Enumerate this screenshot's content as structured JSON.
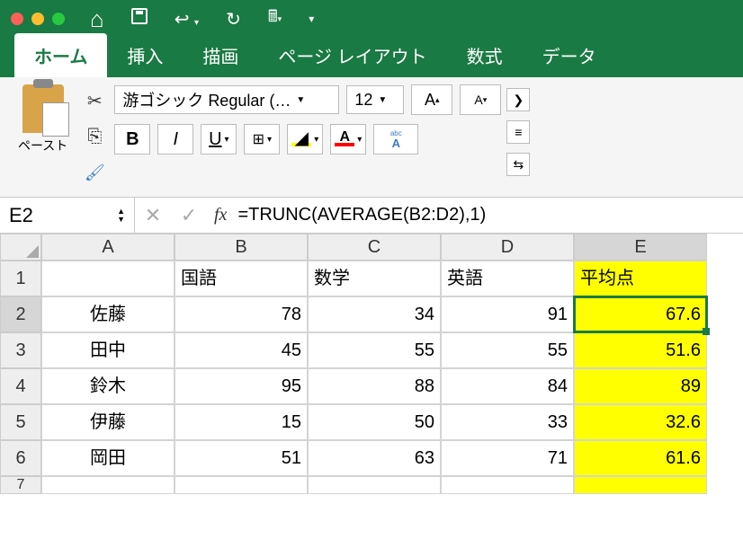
{
  "tabs": {
    "home": "ホーム",
    "insert": "挿入",
    "draw": "描画",
    "pagelayout": "ページ レイアウト",
    "formulas": "数式",
    "data": "データ"
  },
  "ribbon": {
    "paste": "ペースト",
    "font_name": "游ゴシック Regular (…",
    "font_size": "12",
    "bold": "B",
    "italic": "I",
    "underline": "U",
    "ruby_rt": "abc",
    "ruby_base": "A",
    "bigA": "A",
    "smallA": "A"
  },
  "formulabar": {
    "cellref": "E2",
    "fx": "fx",
    "formula": "=TRUNC(AVERAGE(B2:D2),1)"
  },
  "columns": [
    "A",
    "B",
    "C",
    "D",
    "E"
  ],
  "rows": [
    "1",
    "2",
    "3",
    "4",
    "5",
    "6",
    "7"
  ],
  "headers": {
    "B": "国語",
    "C": "数学",
    "D": "英語",
    "E": "平均点"
  },
  "data": [
    {
      "name": "佐藤",
      "b": "78",
      "c": "34",
      "d": "91",
      "e": "67.6"
    },
    {
      "name": "田中",
      "b": "45",
      "c": "55",
      "d": "55",
      "e": "51.6"
    },
    {
      "name": "鈴木",
      "b": "95",
      "c": "88",
      "d": "84",
      "e": "89"
    },
    {
      "name": "伊藤",
      "b": "15",
      "c": "50",
      "d": "33",
      "e": "32.6"
    },
    {
      "name": "岡田",
      "b": "51",
      "c": "63",
      "d": "71",
      "e": "61.6"
    }
  ],
  "chart_data": {
    "type": "table",
    "title": "平均点",
    "columns": [
      "国語",
      "数学",
      "英語",
      "平均点"
    ],
    "rows": [
      "佐藤",
      "田中",
      "鈴木",
      "伊藤",
      "岡田"
    ],
    "values": [
      [
        78,
        34,
        91,
        67.6
      ],
      [
        45,
        55,
        55,
        51.6
      ],
      [
        95,
        88,
        84,
        89
      ],
      [
        15,
        50,
        33,
        32.6
      ],
      [
        51,
        63,
        71,
        61.6
      ]
    ]
  }
}
